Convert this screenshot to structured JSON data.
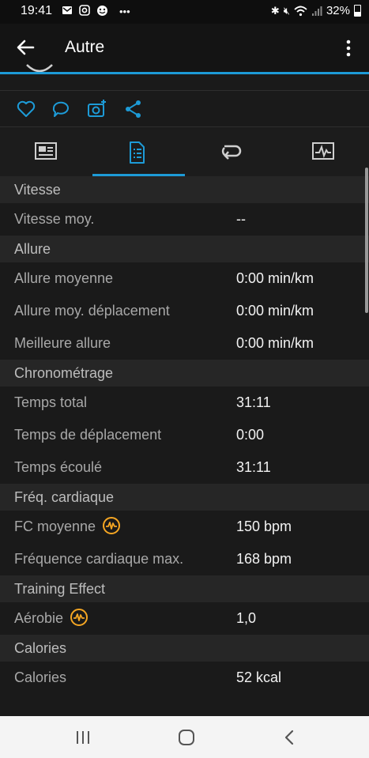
{
  "status_bar": {
    "time": "19:41",
    "battery": "32%",
    "left_icons": [
      "mail-icon",
      "instagram-icon",
      "assistant-icon",
      "more-notifications-icon"
    ],
    "right_icons": [
      "bluetooth-icon",
      "mute-icon",
      "wifi-icon",
      "signal-icon",
      "battery-icon"
    ]
  },
  "app_bar": {
    "title": "Autre"
  },
  "social_actions": [
    "like-icon",
    "comment-icon",
    "add-photo-icon",
    "share-icon"
  ],
  "tabs": [
    {
      "icon": "summary-icon",
      "selected": false
    },
    {
      "icon": "stats-icon",
      "selected": true
    },
    {
      "icon": "laps-icon",
      "selected": false
    },
    {
      "icon": "charts-icon",
      "selected": false
    }
  ],
  "sections": {
    "speed": {
      "title": "Vitesse",
      "rows": [
        {
          "label": "Vitesse moy.",
          "value": "--"
        }
      ]
    },
    "pace": {
      "title": "Allure",
      "rows": [
        {
          "label": "Allure moyenne",
          "value": "0:00 min/km"
        },
        {
          "label": "Allure moy. déplacement",
          "value": "0:00 min/km"
        },
        {
          "label": "Meilleure allure",
          "value": "0:00 min/km"
        }
      ]
    },
    "timing": {
      "title": "Chronométrage",
      "rows": [
        {
          "label": "Temps total",
          "value": "31:11"
        },
        {
          "label": "Temps de déplacement",
          "value": "0:00"
        },
        {
          "label": "Temps écoulé",
          "value": "31:11"
        }
      ]
    },
    "heart_rate": {
      "title": "Fréq. cardiaque",
      "rows": [
        {
          "label": "FC moyenne",
          "value": "150 bpm"
        },
        {
          "label": "Fréquence cardiaque max.",
          "value": "168 bpm"
        }
      ]
    },
    "training_effect": {
      "title": "Training Effect",
      "rows": [
        {
          "label": "Aérobie",
          "value": "1,0"
        }
      ]
    },
    "calories": {
      "title": "Calories",
      "rows": [
        {
          "label": "Calories",
          "value": "52 kcal"
        }
      ]
    }
  },
  "colors": {
    "accent": "#1d9bd7",
    "hr_icon": "#f5a623"
  }
}
